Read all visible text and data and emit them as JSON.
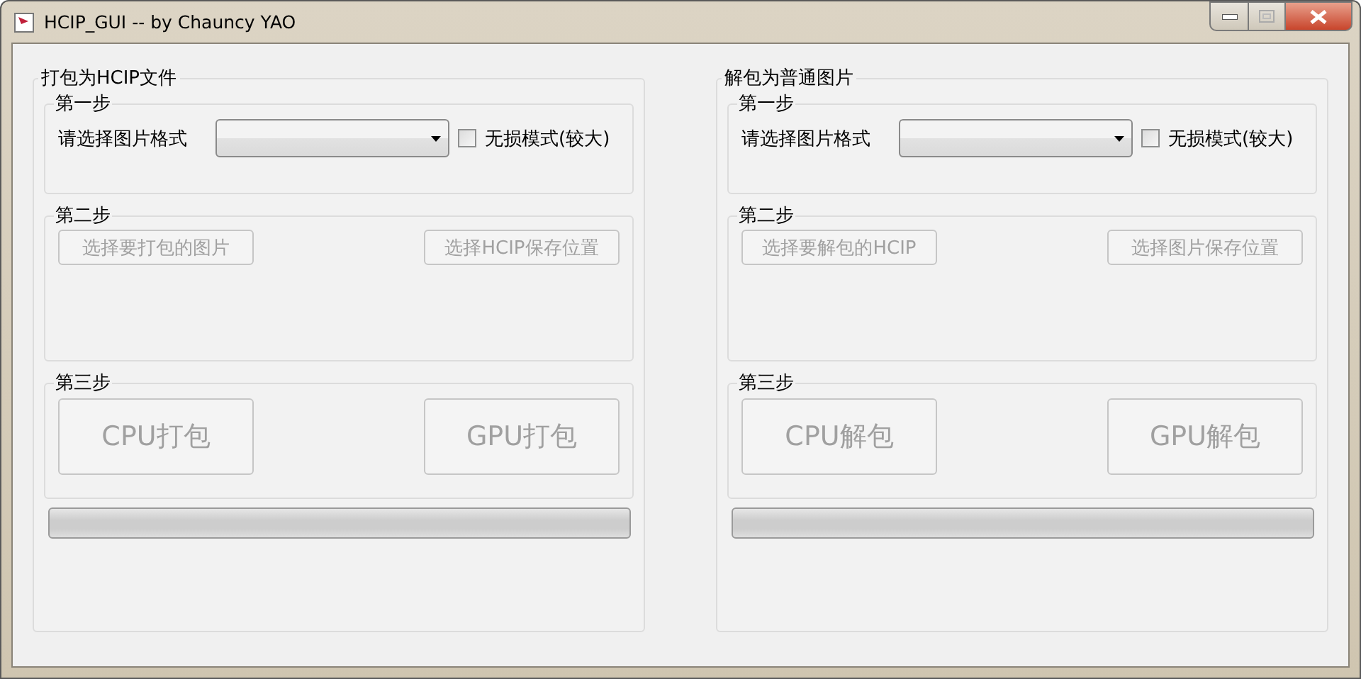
{
  "window": {
    "title": "HCIP_GUI -- by Chauncy YAO"
  },
  "panels": [
    {
      "title": "打包为HCIP文件",
      "step1": {
        "title": "第一步",
        "format_label": "请选择图片格式",
        "lossless": {
          "label": "无损模式(较大)",
          "checked": false
        }
      },
      "step2": {
        "title": "第二步",
        "buttons": [
          {
            "label": "选择要打包的图片",
            "disabled": true
          },
          {
            "label": "选择HCIP保存位置",
            "disabled": true
          }
        ]
      },
      "step3": {
        "title": "第三步",
        "buttons": [
          {
            "label": "CPU打包",
            "disabled": true
          },
          {
            "label": "GPU打包",
            "disabled": true
          }
        ]
      },
      "progress": {
        "level": 0
      }
    },
    {
      "title": "解包为普通图片",
      "step1": {
        "title": "第一步",
        "format_label": "请选择图片格式",
        "lossless": {
          "label": "无损模式(较大)",
          "checked": false
        }
      },
      "step2": {
        "title": "第二步",
        "buttons": [
          {
            "label": "选择要解包的HCIP",
            "disabled": true
          },
          {
            "label": "选择图片保存位置",
            "disabled": true
          }
        ]
      },
      "step3": {
        "title": "第三步",
        "buttons": [
          {
            "label": "CPU解包",
            "disabled": true
          },
          {
            "label": "GPU解包",
            "disabled": true
          }
        ]
      },
      "progress": {
        "level": 0
      }
    }
  ]
}
